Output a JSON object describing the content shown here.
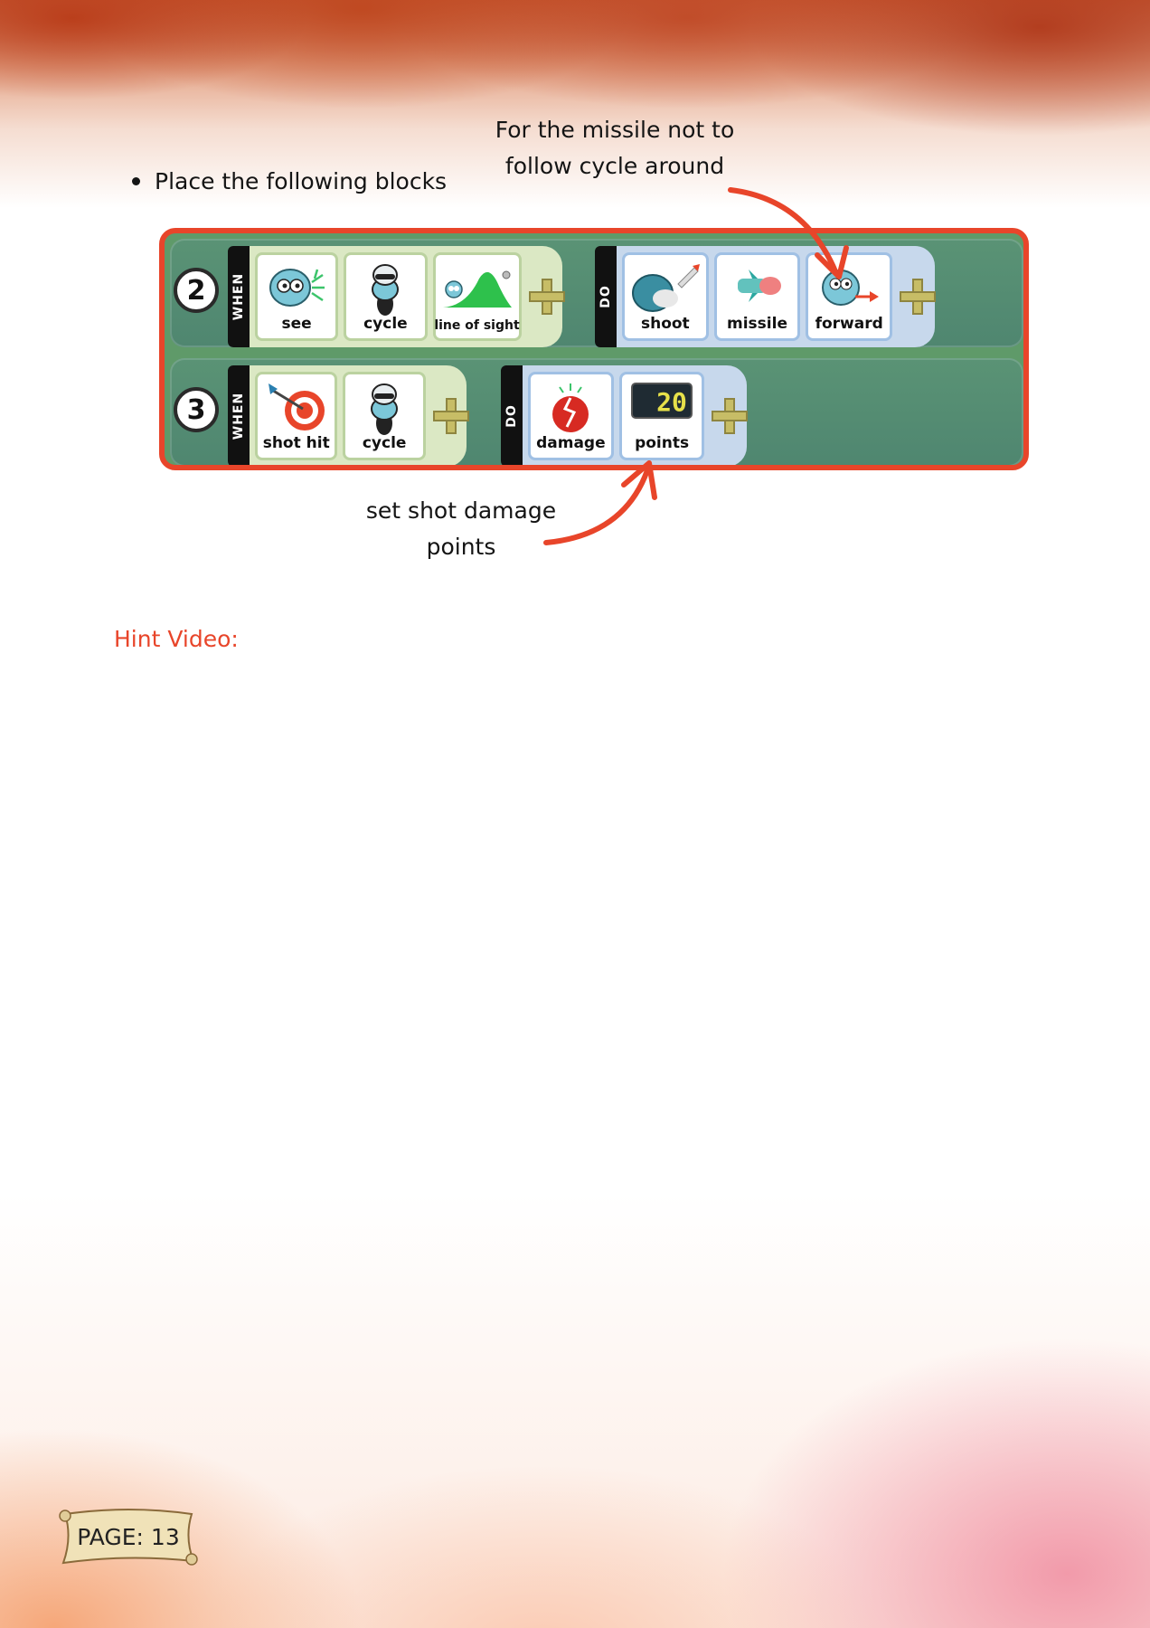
{
  "instruction": "Place the following blocks",
  "annotation_top": [
    "For the missile not to",
    "follow cycle around"
  ],
  "annotation_bottom": [
    "set shot damage",
    "points"
  ],
  "hint_label": "Hint Video:",
  "colors": {
    "accent": "#e8452a",
    "board": "#5f9a69",
    "when_panel": "#dbe8c4",
    "do_panel": "#c7d8ec"
  },
  "rules": [
    {
      "number": "2",
      "when_label": "WHEN",
      "when_tiles": [
        {
          "label": "see",
          "icon": "see-icon"
        },
        {
          "label": "cycle",
          "icon": "cycle-icon"
        },
        {
          "label": "line of sight",
          "icon": "line-of-sight-icon"
        }
      ],
      "do_label": "DO",
      "do_tiles": [
        {
          "label": "shoot",
          "icon": "shoot-icon"
        },
        {
          "label": "missile",
          "icon": "missile-icon"
        },
        {
          "label": "forward",
          "icon": "forward-icon"
        }
      ]
    },
    {
      "number": "3",
      "when_label": "WHEN",
      "when_tiles": [
        {
          "label": "shot hit",
          "icon": "shot-hit-icon"
        },
        {
          "label": "cycle",
          "icon": "cycle-icon"
        }
      ],
      "do_label": "DO",
      "do_tiles": [
        {
          "label": "damage",
          "icon": "damage-icon"
        },
        {
          "label": "points",
          "icon": "points-icon",
          "display": "20"
        }
      ]
    }
  ],
  "page_label": "PAGE: 13"
}
